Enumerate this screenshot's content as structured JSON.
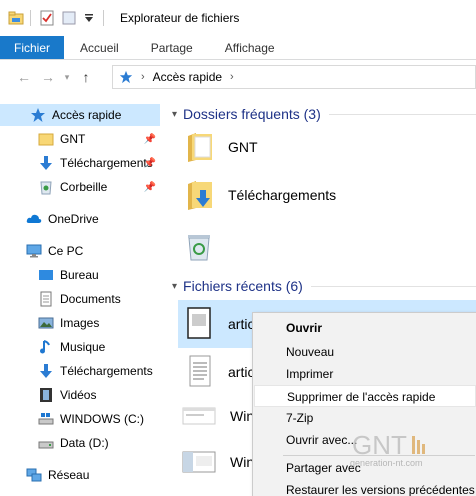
{
  "window": {
    "title": "Explorateur de fichiers"
  },
  "ribbon": {
    "tabs": [
      "Fichier",
      "Accueil",
      "Partage",
      "Affichage"
    ]
  },
  "address": {
    "path": "Accès rapide"
  },
  "nav": {
    "quick_access": "Accès rapide",
    "pinned": [
      "GNT",
      "Téléchargements",
      "Corbeille"
    ],
    "onedrive": "OneDrive",
    "thispc": "Ce PC",
    "pc_items": [
      "Bureau",
      "Documents",
      "Images",
      "Musique",
      "Téléchargements",
      "Vidéos",
      "WINDOWS (C:)",
      "Data (D:)"
    ],
    "network": "Réseau"
  },
  "content": {
    "frequent_header": "Dossiers fréquents (3)",
    "frequent": [
      "GNT",
      "Téléchargements",
      ""
    ],
    "recent_header": "Fichiers récents (6)",
    "recent": [
      "artic",
      "artic",
      "Wind",
      "Wind"
    ]
  },
  "context_menu": {
    "items": [
      "Ouvrir",
      "Nouveau",
      "Imprimer",
      "Supprimer de l'accès rapide",
      "7-Zip",
      "Ouvrir avec...",
      "Partager avec",
      "Restaurer les versions précédentes"
    ],
    "highlighted_index": 3
  },
  "watermark": {
    "brand": "GNT",
    "site": "generation-nt.com"
  },
  "colors": {
    "accent": "#1979ca",
    "header_text": "#1e3287",
    "selection": "#cce8ff",
    "menu_bg": "#f2f2f2"
  }
}
